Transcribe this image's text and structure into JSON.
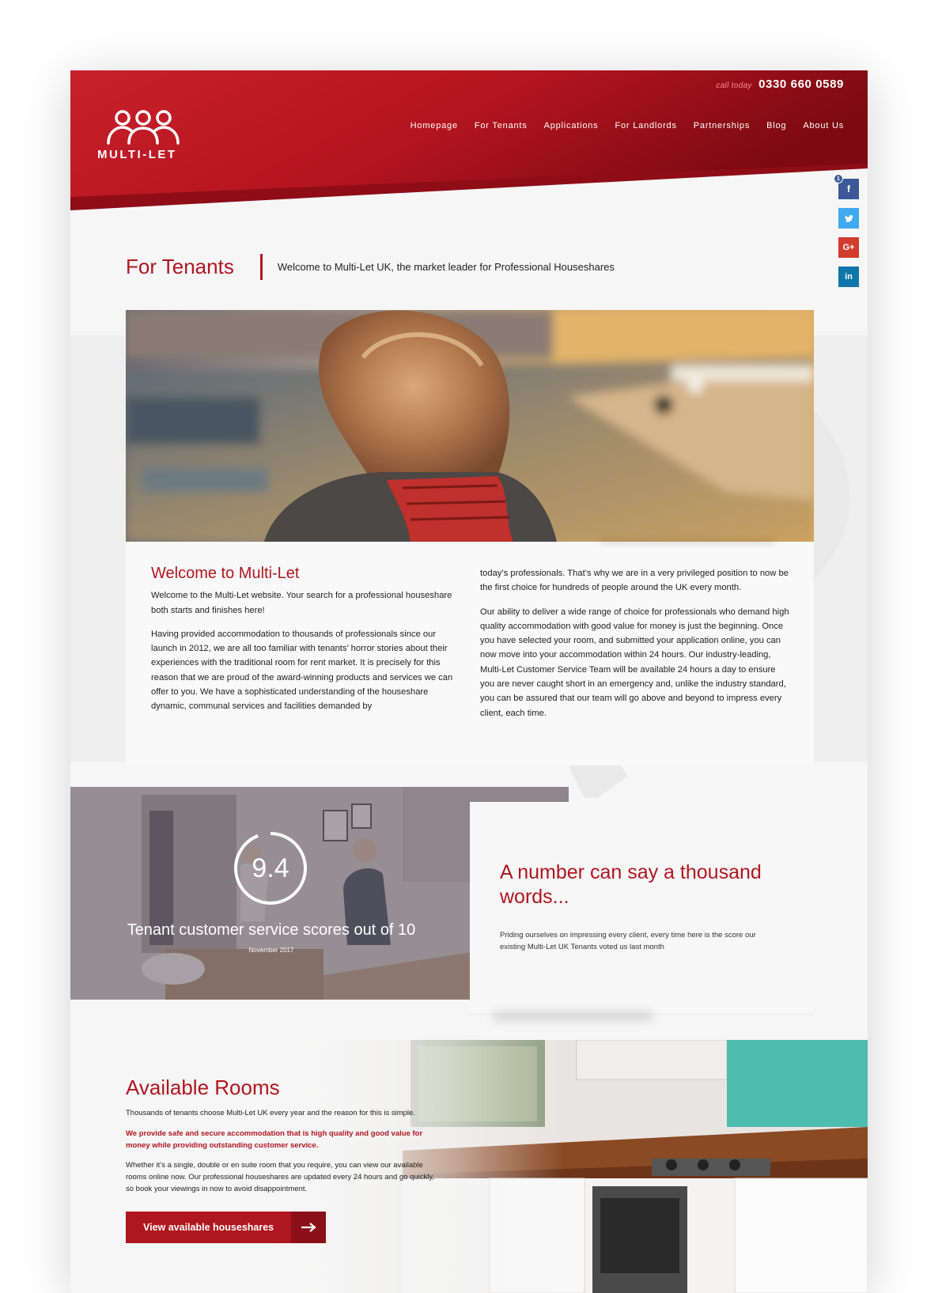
{
  "header": {
    "call_label": "call today",
    "phone": "0330 660 0589",
    "logo_text": "MULTI-LET",
    "nav": [
      "Homepage",
      "For Tenants",
      "Applications",
      "For Landlords",
      "Partnerships",
      "Blog",
      "About Us"
    ]
  },
  "social": {
    "facebook_count": "1",
    "icons": [
      "facebook-icon",
      "twitter-icon",
      "google-plus-icon",
      "linkedin-icon"
    ],
    "labels": {
      "facebook": "f",
      "google": "G+",
      "linkedin": "in"
    }
  },
  "page": {
    "title": "For Tenants",
    "subtitle": "Welcome to Multi-Let UK, the market leader for Professional Houseshares"
  },
  "welcome": {
    "heading": "Welcome to Multi-Let",
    "p1": "Welcome to the Multi-Let website. Your search for a professional houseshare both starts and finishes here!",
    "p2": "Having provided accommodation to thousands of professionals since our launch in 2012, we are all too familiar with tenants’ horror stories about their experiences with the traditional room for rent market. It is precisely for this reason that we are proud of the award-winning products and services we can offer to you. We have a sophisticated understanding of the houseshare dynamic, communal services and facilities demanded by",
    "p3": "today’s professionals. That’s why we are in a very privileged position to now be the first choice for hundreds of people around the UK every month.",
    "p4": "Our ability to deliver a wide range of choice for professionals who demand high quality accommodation with good value for money is just the beginning. Once you have selected your room, and submitted your application online, you can now move into your accommodation within 24 hours. Our industry-leading, Multi-Let Customer Service Team will be available 24 hours a day to ensure you are never caught short in an emergency and, unlike the industry standard, you can be assured that our team will go above and beyond to impress every client, each time."
  },
  "score": {
    "value": "9.4",
    "score_out_of": 10,
    "caption": "Tenant customer service scores out of 10",
    "date": "November 2017"
  },
  "quote": {
    "heading": "A number can say a thousand words...",
    "text": "Priding ourselves on impressing every client, every time here is the score our existing Multi-Let UK Tenants voted us last month"
  },
  "rooms": {
    "heading": "Available Rooms",
    "p1": "Thousands of tenants choose Multi-Let UK every year and the reason for this is simple.",
    "p2": "We provide safe and secure accommodation that is high quality and good value for money while providing outstanding customer service.",
    "p3": "Whether it’s a single, double or en suite room that you require, you can view our available rooms online now. Our professional houseshares are updated every 24 hours and go quickly, so book your viewings in now to avoid disappointment.",
    "button_label": "View available houseshares"
  },
  "colors": {
    "brand_red": "#b0161f",
    "brand_dark_red": "#8b0f18"
  }
}
